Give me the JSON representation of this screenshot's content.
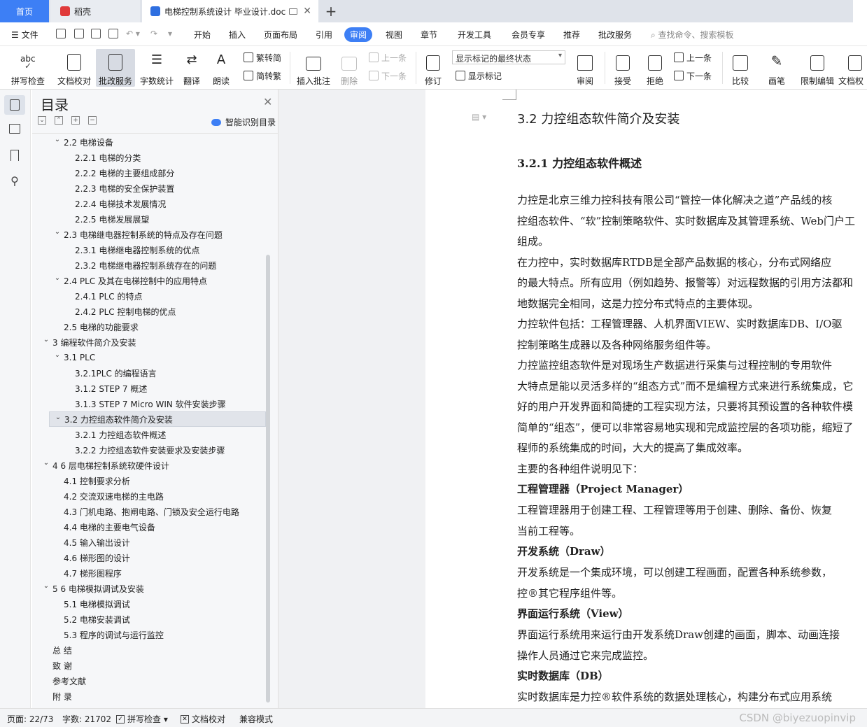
{
  "tabs": {
    "home": "首页",
    "daoke": "稻壳",
    "doc": "电梯控制系统设计 毕业设计.doc"
  },
  "menu": {
    "file": "文件",
    "items": [
      "开始",
      "插入",
      "页面布局",
      "引用",
      "审阅",
      "视图",
      "章节",
      "开发工具",
      "会员专享",
      "推荐",
      "批改服务"
    ],
    "search": "查找命令、搜索模板"
  },
  "ribbon": {
    "spell": "拼写检查",
    "proof": "文档校对",
    "correct": "批改服务",
    "wordcount": "字数统计",
    "translate": "翻译",
    "read": "朗读",
    "trad": "繁转简",
    "simp": "简转繁",
    "insert_comment": "插入批注",
    "delete": "删除",
    "prev": "上一条",
    "next": "下一条",
    "revise": "修订",
    "markup_select": "显示标记的最终状态",
    "show_markup": "显示标记",
    "review": "审阅",
    "accept": "接受",
    "reject": "拒绝",
    "prev2": "上一条",
    "next2": "下一条",
    "compare": "比较",
    "pen": "画笔",
    "restrict": "限制编辑",
    "docperm": "文档权"
  },
  "nav": {
    "title": "目录",
    "smart": "智能识别目录",
    "toc": [
      {
        "text": "2.2  电梯设备",
        "level": 2,
        "expanded": true
      },
      {
        "text": "2.2.1  电梯的分类",
        "level": 3
      },
      {
        "text": "2.2.2  电梯的主要组成部分",
        "level": 3
      },
      {
        "text": "2.2.3  电梯的安全保护装置",
        "level": 3
      },
      {
        "text": "2.2.4  电梯技术发展情况",
        "level": 3
      },
      {
        "text": "2.2.5  电梯发展展望",
        "level": 3
      },
      {
        "text": "2.3 电梯继电器控制系统的特点及存在问题",
        "level": 2,
        "expanded": true
      },
      {
        "text": "2.3.1 电梯继电器控制系统的优点",
        "level": 3
      },
      {
        "text": "2.3.2 电梯继电器控制系统存在的问题",
        "level": 3
      },
      {
        "text": "2.4 PLC 及其在电梯控制中的应用特点",
        "level": 2,
        "expanded": true
      },
      {
        "text": "2.4.1 PLC  的特点",
        "level": 3
      },
      {
        "text": "2.4.2 PLC  控制电梯的优点",
        "level": 3
      },
      {
        "text": "2.5 电梯的功能要求",
        "level": 2
      },
      {
        "text": "3 编程软件简介及安装",
        "level": 1,
        "expanded": true
      },
      {
        "text": "3.1 PLC",
        "level": 2,
        "expanded": true
      },
      {
        "text": "3.2.1PLC 的编程语言",
        "level": 3
      },
      {
        "text": "3.1.2 STEP 7 概述",
        "level": 3
      },
      {
        "text": "3.1.3 STEP  7 Micro WIN 软件安装步骤",
        "level": 3
      },
      {
        "text": "3.2 力控组态软件简介及安装",
        "level": 2,
        "expanded": true,
        "selected": true
      },
      {
        "text": "3.2.1 力控组态软件概述",
        "level": 3
      },
      {
        "text": "3.2.2 力控组态软件安装要求及安装步骤",
        "level": 3
      },
      {
        "text": "4 6 层电梯控制系统软硬件设计",
        "level": 1,
        "expanded": true
      },
      {
        "text": "4.1 控制要求分析",
        "level": 2
      },
      {
        "text": "4.2 交流双速电梯的主电路",
        "level": 2
      },
      {
        "text": "4.3 门机电路、抱闸电路、门锁及安全运行电路",
        "level": 2
      },
      {
        "text": "4.4 电梯的主要电气设备",
        "level": 2
      },
      {
        "text": "4.5 输入输出设计",
        "level": 2
      },
      {
        "text": "4.6 梯形图的设计",
        "level": 2
      },
      {
        "text": "4.7 梯形图程序",
        "level": 2
      },
      {
        "text": "5 6 电梯模拟调试及安装",
        "level": 1,
        "expanded": true
      },
      {
        "text": "5.1  电梯模拟调试",
        "level": 2
      },
      {
        "text": "5.2  电梯安装调试",
        "level": 2
      },
      {
        "text": "5.3  程序的调试与运行监控",
        "level": 2
      },
      {
        "text": "总    结",
        "level": 1,
        "plain": true
      },
      {
        "text": "致    谢",
        "level": 1,
        "plain": true
      },
      {
        "text": "参考文献",
        "level": 1,
        "plain": true
      },
      {
        "text": "附    录",
        "level": 1,
        "plain": true
      }
    ]
  },
  "doc": {
    "h2": "3.2 力控组态软件简介及安装",
    "h3": "3.2.1 力控组态软件概述",
    "lines": [
      {
        "text": "        力控是北京三维力控科技有限公司“管控一体化解决之道”产品线的核",
        "bold": false
      },
      {
        "text": "控组态软件、“软”控制策略软件、实时数据库及其管理系统、Web门户工",
        "bold": false
      },
      {
        "text": "组成。",
        "bold": false
      },
      {
        "text": "        在力控中，实时数据库RTDB是全部产品数据的核心，分布式网络应",
        "bold": false
      },
      {
        "text": "的最大特点。所有应用（例如趋势、报警等）对远程数据的引用方法都和",
        "bold": false
      },
      {
        "text": "地数据完全相同，这是力控分布式特点的主要体现。",
        "bold": false
      },
      {
        "text": "        力控软件包括：工程管理器、人机界面VIEW、实时数据库DB、I/O驱",
        "bold": false
      },
      {
        "text": "控制策略生成器以及各种网络服务组件等。",
        "bold": false
      },
      {
        "text": "        力控监控组态软件是对现场生产数据进行采集与过程控制的专用软件",
        "bold": false
      },
      {
        "text": "大特点是能以灵活多样的“组态方式”而不是编程方式来进行系统集成，它",
        "bold": false
      },
      {
        "text": "好的用户开发界面和简捷的工程实现方法，只要将其预设置的各种软件模",
        "bold": false
      },
      {
        "text": "简单的“组态”，便可以非常容易地实现和完成监控层的各项功能，缩短了",
        "bold": false
      },
      {
        "text": "程师的系统集成的时间，大大的提高了集成效率。",
        "bold": false
      },
      {
        "text": "        主要的各种组件说明见下：",
        "bold": false
      },
      {
        "text": "        工程管理器（Project Manager）",
        "bold": true
      },
      {
        "text": "        工程管理器用于创建工程、工程管理等用于创建、删除、备份、恢复",
        "bold": false
      },
      {
        "text": "当前工程等。",
        "bold": false
      },
      {
        "text": "        开发系统（Draw）",
        "bold": true
      },
      {
        "text": "        开发系统是一个集成环境，可以创建工程画面，配置各种系统参数，",
        "bold": false
      },
      {
        "text": "控®其它程序组件等。",
        "bold": false
      },
      {
        "text": "        界面运行系统（View）",
        "bold": true
      },
      {
        "text": "        界面运行系统用来运行由开发系统Draw创建的画面，脚本、动画连接",
        "bold": false
      },
      {
        "text": "操作人员通过它来完成监控。",
        "bold": false
      },
      {
        "text": "        实时数据库（DB）",
        "bold": true
      },
      {
        "text": "        实时数据库是力控®软件系统的数据处理核心，构建分布式应用系统",
        "bold": false
      }
    ]
  },
  "status": {
    "page": "页面: 22/73",
    "words": "字数: 21702",
    "spell": "拼写检查",
    "proof": "文档校对",
    "compat": "兼容模式"
  },
  "watermark": "CSDN @biyezuopinvip",
  "colors": {
    "accent": "#3d7ff5",
    "tabbar": "#dfe3ea"
  }
}
